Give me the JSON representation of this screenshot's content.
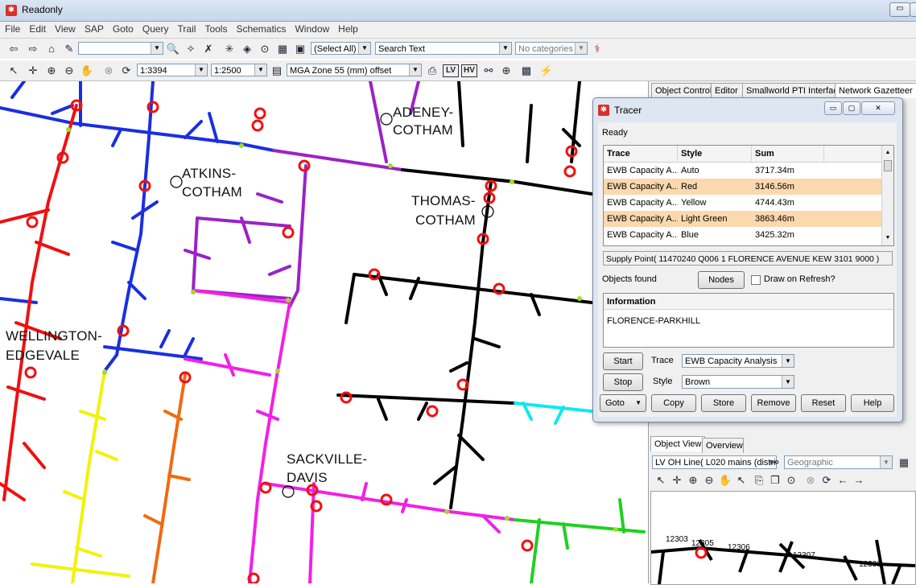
{
  "window": {
    "title": "Readonly"
  },
  "menu": [
    "File",
    "Edit",
    "View",
    "SAP",
    "Goto",
    "Query",
    "Trail",
    "Tools",
    "Schematics",
    "Window",
    "Help"
  ],
  "toolbar1": {
    "select_filter": "(Select All)",
    "search_text": "Search Text",
    "categories": "No categories"
  },
  "toolbar2": {
    "scale_current": "1:3394",
    "scale_set": "1:2500",
    "projection": "MGA Zone 55 (mm) offset",
    "lv_label": "LV",
    "hv_label": "HV"
  },
  "map": {
    "labels": [
      "ADENEY-",
      "COTHAM",
      "ATKINS-",
      "COTHAM",
      "THOMAS-",
      "COTHAM",
      "WELLINGTON-",
      "EDGEVALE",
      "SACKVILLE-",
      "DAVIS"
    ],
    "colors": {
      "blue": "#1a2fe0",
      "red": "#f01010",
      "purple": "#9b22c6",
      "magenta": "#f020e8",
      "yellow": "#f2f20a",
      "orange": "#f06a10",
      "black": "#000000",
      "cyan": "#10e8f0",
      "green": "#20d020"
    }
  },
  "right_tabs": [
    "Object Control",
    "Editor",
    "Smallworld PTI Interface",
    "Network Gazetteer"
  ],
  "tracer": {
    "title": "Tracer",
    "status": "Ready",
    "columns": [
      "Trace",
      "Style",
      "Sum"
    ],
    "rows": [
      {
        "trace": "EWB Capacity A...",
        "style": "Auto",
        "sum": "3717.34m",
        "selected": false
      },
      {
        "trace": "EWB Capacity A...",
        "style": "Red",
        "sum": "3146.56m",
        "selected": true
      },
      {
        "trace": "EWB Capacity A...",
        "style": "Yellow",
        "sum": "4744.43m",
        "selected": false
      },
      {
        "trace": "EWB Capacity A...",
        "style": "Light Green",
        "sum": "3863.46m",
        "selected": true
      },
      {
        "trace": "EWB Capacity A...",
        "style": "Blue",
        "sum": "3425.32m",
        "selected": false
      }
    ],
    "supply_point": "Supply Point( 11470240 Q006 1 FLORENCE AVENUE  KEW 3101 9000 )",
    "objects_found": "Objects found",
    "nodes_button": "Nodes",
    "draw_on_refresh": "Draw on Refresh?",
    "info_header": "Information",
    "info_value": "FLORENCE-PARKHILL",
    "start": "Start",
    "stop": "Stop",
    "trace_label": "Trace",
    "trace_value": "EWB Capacity Analysis",
    "style_label": "Style",
    "style_value": "Brown",
    "goto": "Goto",
    "copy": "Copy",
    "store": "Store",
    "remove": "Remove",
    "reset": "Reset",
    "help": "Help"
  },
  "object_view": {
    "tabs": [
      "Object View",
      "Overview"
    ],
    "object": "LV OH Line( L020 mains (distrib",
    "view_mode": "Geographic",
    "numbers": [
      "12303",
      "12305",
      "12306",
      "12307",
      "12308"
    ]
  }
}
